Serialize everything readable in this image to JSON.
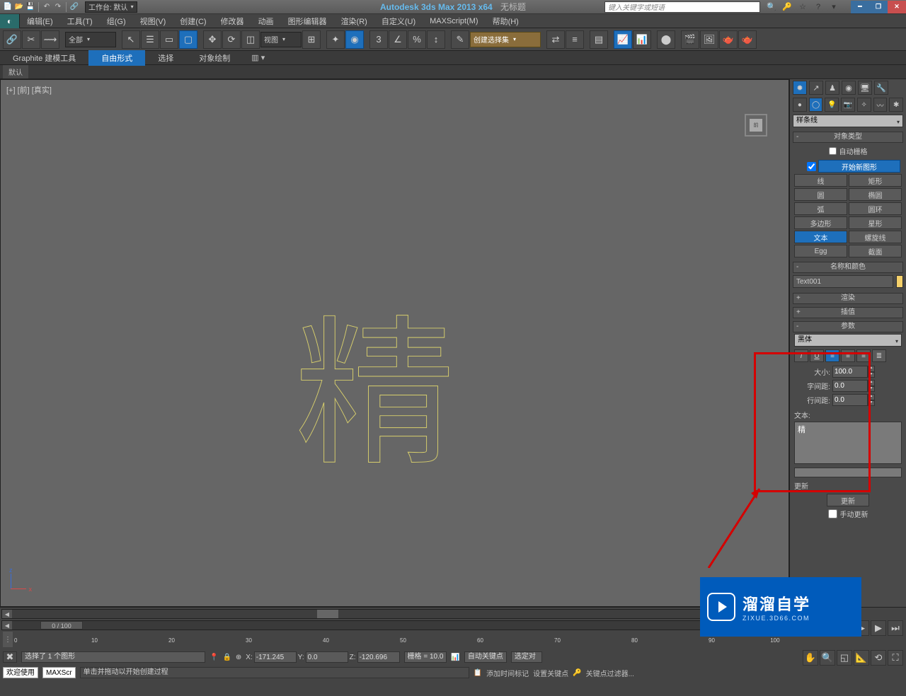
{
  "titlebar": {
    "workspace_label": "工作台: 默认",
    "app_title": "Autodesk 3ds Max  2013 x64",
    "doc_title": "无标题",
    "search_placeholder": "键入关键字或短语"
  },
  "menu": {
    "edit": "编辑(E)",
    "tools": "工具(T)",
    "group": "组(G)",
    "views": "视图(V)",
    "create": "创建(C)",
    "modifiers": "修改器",
    "animation": "动画",
    "graph": "图形编辑器",
    "render": "渲染(R)",
    "customize": "自定义(U)",
    "maxscript": "MAXScript(M)",
    "help": "帮助(H)"
  },
  "toolbar": {
    "filter_all": "全部",
    "view_combo": "视图",
    "selset_placeholder": "创建选择集"
  },
  "graphite": {
    "tab1": "Graphite 建模工具",
    "tab2": "自由形式",
    "tab3": "选择",
    "tab4": "对象绘制",
    "default_label": "默认"
  },
  "viewport": {
    "label_left": "[+] [前] [真实]",
    "cube_face": "前",
    "object_text": "精"
  },
  "cmd": {
    "spline_combo": "样条线",
    "object_type_title": "对象类型",
    "autogrid": "自动栅格",
    "start_new_shape": "开始新图形",
    "btn_line": "线",
    "btn_rectangle": "矩形",
    "btn_circle": "圆",
    "btn_ellipse": "椭圆",
    "btn_arc": "弧",
    "btn_donut": "圆环",
    "btn_ngon": "多边形",
    "btn_star": "星形",
    "btn_text": "文本",
    "btn_helix": "螺旋线",
    "btn_egg": "Egg",
    "btn_section": "截面",
    "name_and_color_title": "名称和颜色",
    "object_name": "Text001",
    "render_title": "渲染",
    "interp_title": "插值",
    "params_title": "参数",
    "font_name": "黑体",
    "size_label": "大小:",
    "size_value": "100.0",
    "kerning_label": "字间距:",
    "kerning_value": "0.0",
    "leading_label": "行间距:",
    "leading_value": "0.0",
    "text_label": "文本:",
    "text_content": "精",
    "update_section": "更新",
    "update_btn": "更新",
    "manual_update": "手动更新"
  },
  "bottom": {
    "time_display": "0 / 100",
    "ticks": [
      "0",
      "10",
      "20",
      "30",
      "40",
      "50",
      "60",
      "70",
      "80",
      "90",
      "100"
    ],
    "selected_msg": "选择了 1 个图形",
    "x_label": "X:",
    "x_val": "-171.245",
    "y_label": "Y:",
    "y_val": "0.0",
    "z_label": "Z:",
    "z_val": "-120.696",
    "grid_label": "栅格 = 10.0",
    "auto_key": "自动关键点",
    "select_key": "选定对",
    "welcome": "欢迎使用",
    "maxscr": "MAXScr",
    "prompt": "单击并拖动以开始创建过程",
    "add_time_tag": "添加时间标记",
    "set_key": "设置关键点",
    "key_filter": "关键点过滤器..."
  },
  "watermark": {
    "line1": "溜溜自学",
    "line2": "ZIXUE.3D66.COM"
  }
}
